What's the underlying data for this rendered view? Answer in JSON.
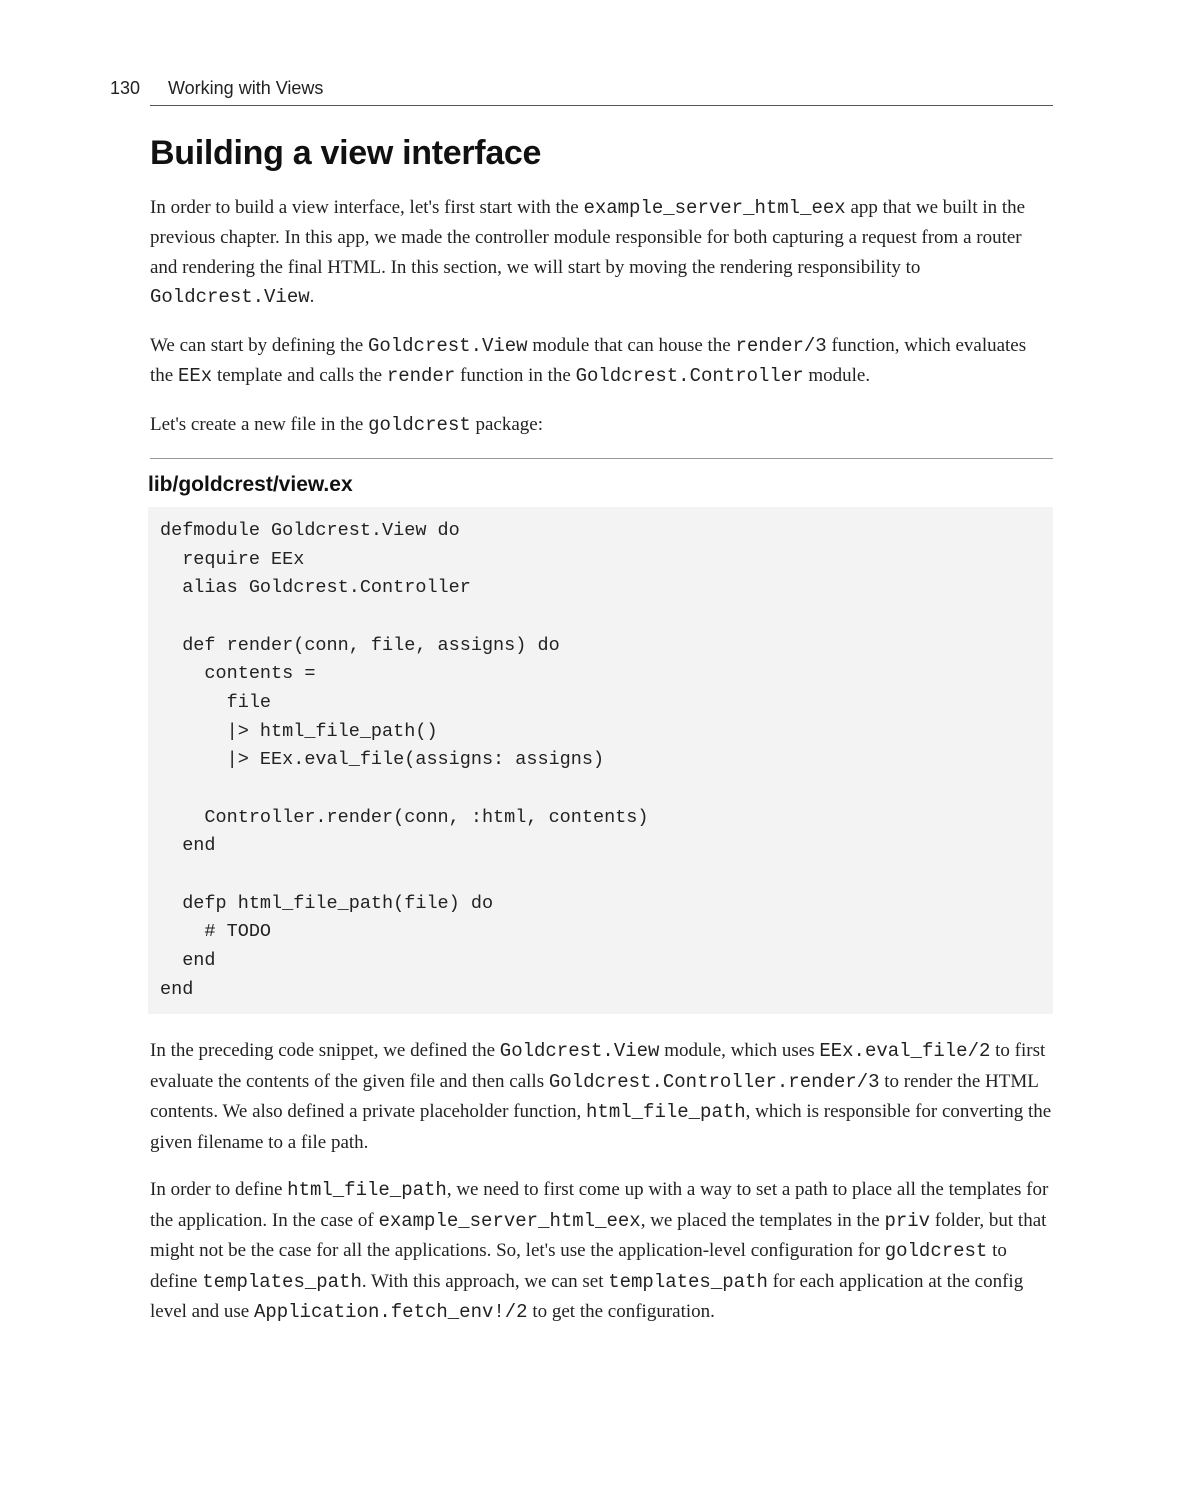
{
  "page_number": "130",
  "chapter_title": "Working with Views",
  "section_title": "Building a view interface",
  "para1_a": "In order to build a view interface, let's first start with the ",
  "para1_code1": "example_server_html_eex",
  "para1_b": " app that we built in the previous chapter. In this app, we made the controller module responsible for both capturing a request from a router and rendering the final HTML. In this section, we will start by moving the rendering responsibility to ",
  "para1_code2": "Goldcrest.View",
  "para1_c": ".",
  "para2_a": "We can start by defining the ",
  "para2_code1": "Goldcrest.View",
  "para2_b": " module that can house the ",
  "para2_code2": "render/3",
  "para2_c": " function, which evaluates the ",
  "para2_code3": "EEx",
  "para2_d": " template and calls the ",
  "para2_code4": "render",
  "para2_e": " function in the ",
  "para2_code5": "Goldcrest.Controller",
  "para2_f": " module.",
  "para3_a": "Let's create a new file in the ",
  "para3_code1": "goldcrest",
  "para3_b": " package:",
  "file_label": "lib/goldcrest/view.ex",
  "codeblock": "defmodule Goldcrest.View do\n  require EEx\n  alias Goldcrest.Controller\n\n  def render(conn, file, assigns) do\n    contents =\n      file\n      |> html_file_path()\n      |> EEx.eval_file(assigns: assigns)\n\n    Controller.render(conn, :html, contents)\n  end\n\n  defp html_file_path(file) do\n    # TODO\n  end\nend",
  "para4_a": "In the preceding code snippet, we defined the ",
  "para4_code1": "Goldcrest.View",
  "para4_b": " module, which uses ",
  "para4_code2": "EEx.eval_file/2",
  "para4_c": " to first evaluate the contents of the given file and then calls ",
  "para4_code3": "Goldcrest.Controller.render/3",
  "para4_d": " to render the HTML contents. We also defined a private placeholder function, ",
  "para4_code4": "html_file_path",
  "para4_e": ", which is responsible for converting the given filename to a file path.",
  "para5_a": "In order to define ",
  "para5_code1": "html_file_path",
  "para5_b": ", we need to first come up with a way to set a path to place all the templates for the application. In the case of ",
  "para5_code2": "example_server_html_eex",
  "para5_c": ", we placed the templates in the ",
  "para5_code3": "priv",
  "para5_d": " folder, but that might not be the case for all the applications. So, let's use the application-level configuration for ",
  "para5_code4": "goldcrest",
  "para5_e": " to define ",
  "para5_code5": "templates_path",
  "para5_f": ". With this approach, we can set ",
  "para5_code6": "templates_path",
  "para5_g": " for each application at the config level and use ",
  "para5_code7": "Application.fetch_env!/2",
  "para5_h": " to get the configuration."
}
